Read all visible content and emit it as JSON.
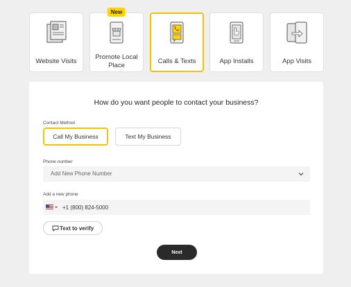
{
  "goals": [
    {
      "label": "Website Visits",
      "icon": "website-icon",
      "selected": false
    },
    {
      "label": "Promote Local Place",
      "icon": "storefront-icon",
      "selected": false
    },
    {
      "label": "Calls & Texts",
      "icon": "phone-call-icon",
      "selected": true
    },
    {
      "label": "App Installs",
      "icon": "app-install-icon",
      "selected": false
    },
    {
      "label": "App Visits",
      "icon": "app-visit-icon",
      "selected": false
    }
  ],
  "new_badge": "New",
  "form": {
    "heading": "How do you want people to contact your business?",
    "contact_method_label": "Contact Method",
    "methods": [
      "Call My Business",
      "Text My Business"
    ],
    "selected_method": "Call My Business",
    "phone_number_label": "Phone number",
    "phone_select_value": "Add New Phone Number",
    "add_phone_label": "Add a new phone",
    "phone_value": "+1 (800) 824-5000",
    "country_flag": "us-flag-icon",
    "verify_label": "Text to verify",
    "next_label": "Next"
  },
  "colors": {
    "accent": "#f2c200",
    "badge": "#ffd400",
    "next_button": "#2a2a2a",
    "background": "#efefef"
  }
}
